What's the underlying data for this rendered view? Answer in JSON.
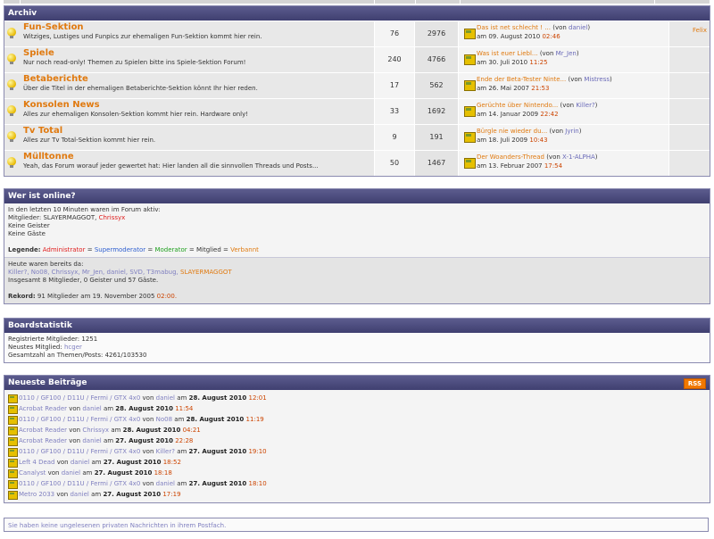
{
  "archive": {
    "header": "Archiv",
    "forums": [
      {
        "name": "Fun-Sektion",
        "desc": "Witziges, Lustiges und Funpics zur ehemaligen Fun-Sektion kommt hier rein.",
        "topics": "76",
        "posts": "2976",
        "last_title": "Das ist net schlecht ! ...",
        "last_user": "daniel",
        "last_date": "am 09. August 2010",
        "last_time": "02:46",
        "mod": "Felix"
      },
      {
        "name": "Spiele",
        "desc": "Nur noch read-only! Themen zu Spielen bitte ins Spiele-Sektion Forum!",
        "topics": "240",
        "posts": "4766",
        "last_title": "Was ist euer Liebl...",
        "last_user": "Mr_Jen",
        "last_date": "am 30. Juli 2010",
        "last_time": "11:25",
        "mod": ""
      },
      {
        "name": "Betaberichte",
        "desc": "Über die Titel in der ehemaligen Betaberichte-Sektion könnt Ihr hier reden.",
        "topics": "17",
        "posts": "562",
        "last_title": "Ende der Beta-Tester Ninte...",
        "last_user": "Mistress",
        "last_date": "am 26. Mai 2007",
        "last_time": "21:53",
        "mod": ""
      },
      {
        "name": "Konsolen News",
        "desc": "Alles zur ehemaligen Konsolen-Sektion kommt hier rein. Hardware only!",
        "topics": "33",
        "posts": "1692",
        "last_title": "Gerüchte über Nintendo...",
        "last_user": "Killer?",
        "last_date": "am 14. Januar 2009",
        "last_time": "22:42",
        "mod": ""
      },
      {
        "name": "Tv Total",
        "desc": "Alles zur Tv Total-Sektion kommt hier rein.",
        "topics": "9",
        "posts": "191",
        "last_title": "Bürgle nie wieder du...",
        "last_user": "Jyrin",
        "last_date": "am 18. Juli 2009",
        "last_time": "10:43",
        "mod": ""
      },
      {
        "name": "Mülltonne",
        "desc": "Yeah, das Forum worauf jeder gewertet hat: Hier landen all die sinnvollen Threads und Posts...",
        "topics": "50",
        "posts": "1467",
        "last_title": "Der Woanders-Thread",
        "last_user": "X-1-ALPHA",
        "last_date": "am 13. Februar 2007",
        "last_time": "17:54",
        "mod": ""
      }
    ],
    "last_by_prefix": "(von",
    "last_by_suffix": ")"
  },
  "online": {
    "header": "Wer ist online?",
    "line1": "In den letzten 10 Minuten waren im Forum aktiv:",
    "members_label": "Mitglieder:",
    "member1": "SLAYERMAGGOT,",
    "member2": "Chrissyx",
    "line3": "Keine Geister",
    "line4": "Keine Gäste",
    "legend_label": "Legende:",
    "legend_admin": "Administrator",
    "legend_sep": "=",
    "legend_smod": "Supermoderator",
    "legend_mod": "Moderator",
    "legend_member": "Mitglied",
    "legend_banned": "Verbannt",
    "today_label": "Heute waren bereits da:",
    "today_users": "Killer?, No08, Chrissyx, Mr_Jen, daniel, SVD, T3mabug,",
    "today_last": "SLAYERMAGGOT",
    "today_total": "Insgesamt 8 Mitglieder, 0 Geister und 57 Gäste.",
    "record_label": "Rekord:",
    "record_text": "91 Mitglieder am 19. November 2005",
    "record_time": "02:00."
  },
  "stats": {
    "header": "Boardstatistik",
    "line1": "Registrierte Mitglieder: 1251",
    "newest_label": "Neustes Mitglied:",
    "newest_user": "hcger",
    "line3": "Gesamtzahl an Themen/Posts: 4261/103530"
  },
  "newest": {
    "header": "Neueste Beiträge",
    "rss_label": "RSS",
    "by": "von",
    "on": "am",
    "posts": [
      {
        "title": "0110 / GF100 / D11U / Fermi / GTX 4x0",
        "user": "daniel",
        "date": "28. August 2010",
        "time": "12:01"
      },
      {
        "title": "Acrobat Reader",
        "user": "daniel",
        "date": "28. August 2010",
        "time": "11:54"
      },
      {
        "title": "0110 / GF100 / D11U / Fermi / GTX 4x0",
        "user": "No08",
        "date": "28. August 2010",
        "time": "11:19"
      },
      {
        "title": "Acrobat Reader",
        "user": "Chrissyx",
        "date": "28. August 2010",
        "time": "04:21"
      },
      {
        "title": "Acrobat Reader",
        "user": "daniel",
        "date": "27. August 2010",
        "time": "22:28"
      },
      {
        "title": "0110 / GF100 / D11U / Fermi / GTX 4x0",
        "user": "Killer?",
        "date": "27. August 2010",
        "time": "19:10"
      },
      {
        "title": "Left 4 Dead",
        "user": "daniel",
        "date": "27. August 2010",
        "time": "18:52"
      },
      {
        "title": "Canalyst",
        "user": "daniel",
        "date": "27. August 2010",
        "time": "18:18"
      },
      {
        "title": "0110 / GF100 / D11U / Fermi / GTX 4x0",
        "user": "daniel",
        "date": "27. August 2010",
        "time": "18:10"
      },
      {
        "title": "Metro 2033",
        "user": "daniel",
        "date": "27. August 2010",
        "time": "17:19"
      }
    ]
  },
  "footer": {
    "text": "Sie haben keine ungelesenen privaten Nachrichten in ihrem Postfach."
  }
}
